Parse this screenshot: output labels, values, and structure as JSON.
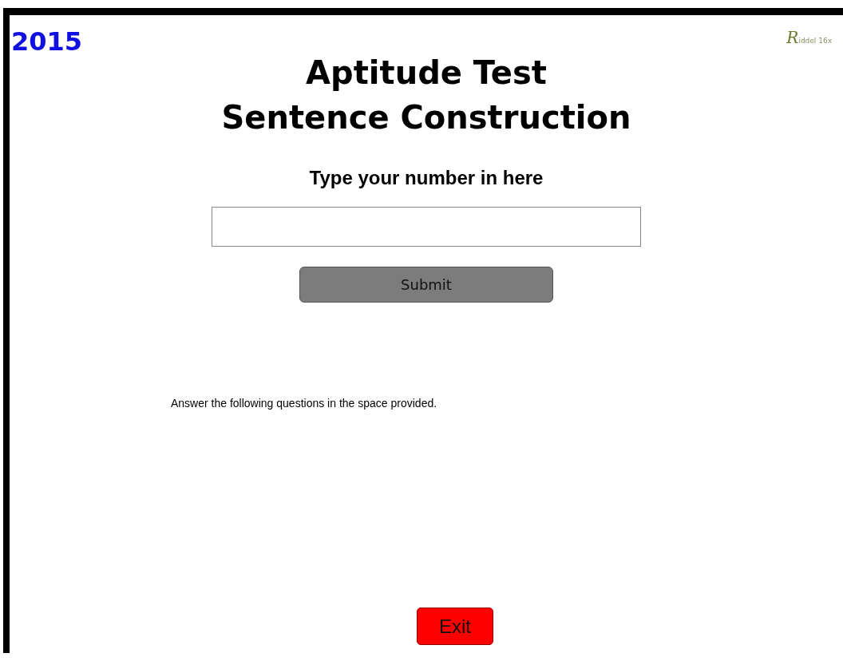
{
  "year": "2015",
  "logo": {
    "initial": "R",
    "text": "iddel 16x"
  },
  "title_lines": [
    "Aptitude Test",
    "Sentence Construction"
  ],
  "number_prompt": "Type your number in here",
  "submit_button": "Submit",
  "instructions": "Answer the following questions in the space provided.",
  "exit_button": "Exit"
}
